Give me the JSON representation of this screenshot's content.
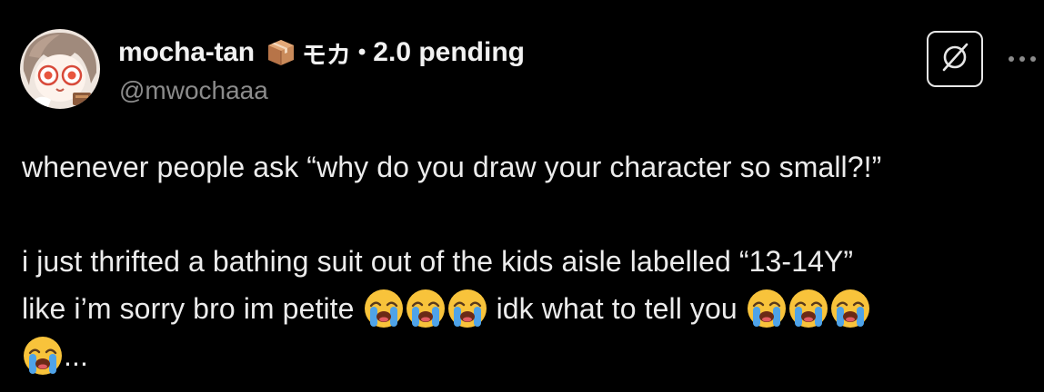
{
  "author": {
    "display_name": "mocha-tan",
    "emoji_badge": "package-box-emoji",
    "kana_name": "モカ",
    "separator": "•",
    "status": "2.0 pending",
    "handle": "@mwochaaa"
  },
  "actions": {
    "grok_icon": "grok-slash-circle-icon",
    "more_icon": "more-dots-icon"
  },
  "post": {
    "line1": "whenever people ask “why do you draw your character so small?!”",
    "line2": "i just thrifted a bathing suit out of the kids aisle labelled “13-14Y”",
    "line3a": "like i’m sorry bro im petite",
    "line3b": "idk what to tell you",
    "line4_suffix": "...",
    "emoji": "loudly-crying-face-emoji"
  },
  "colors": {
    "background": "#000000",
    "primary_text": "#ececec",
    "secondary_text": "#8b8b8b"
  }
}
